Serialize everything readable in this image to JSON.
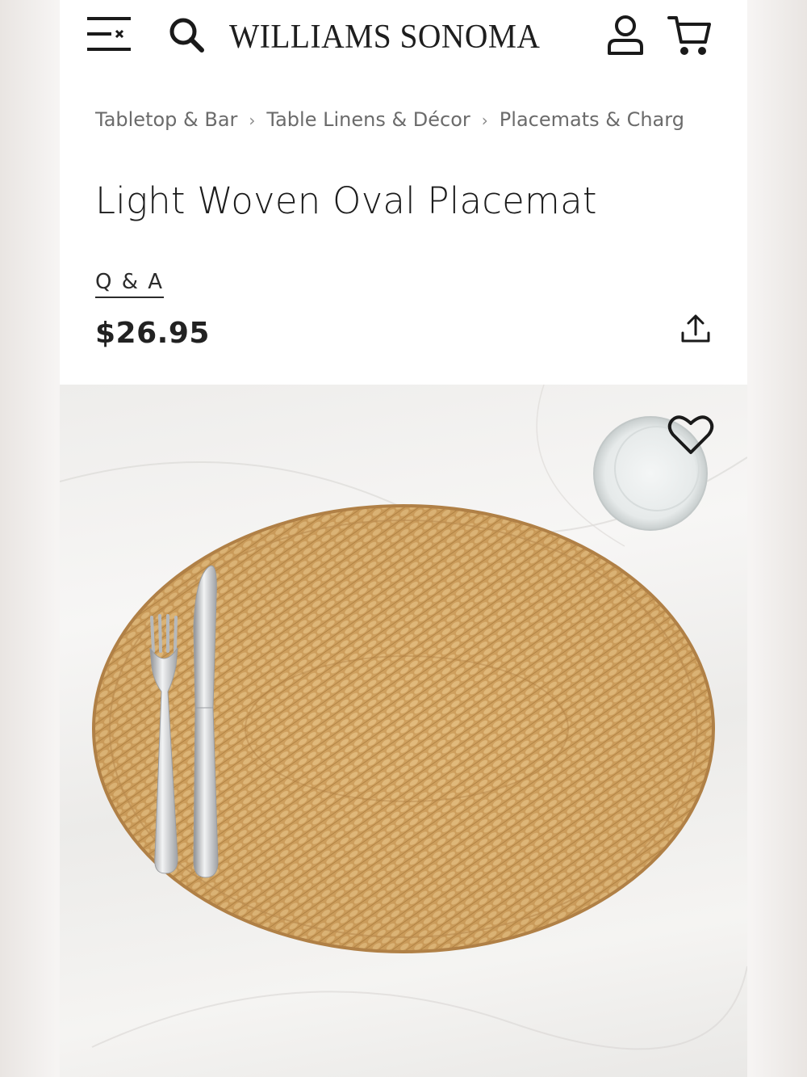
{
  "header": {
    "brand": "WILLIAMS SONOMA",
    "icons": {
      "menu": "menu-icon",
      "search": "search-icon",
      "account": "account-icon",
      "cart": "cart-icon"
    }
  },
  "breadcrumb": {
    "items": [
      "Tabletop & Bar",
      "Table Linens & Décor",
      "Placemats & Charg"
    ],
    "separator": "›"
  },
  "product": {
    "title": "Light Woven Oval Placemat",
    "qa_label": "Q & A",
    "price": "$26.95",
    "share_icon": "share-icon",
    "favorite_icon": "heart-icon"
  },
  "colors": {
    "text": "#1c1c1c",
    "muted": "#6b6b6b",
    "rattan": "#c99a55",
    "background": "#ffffff"
  }
}
